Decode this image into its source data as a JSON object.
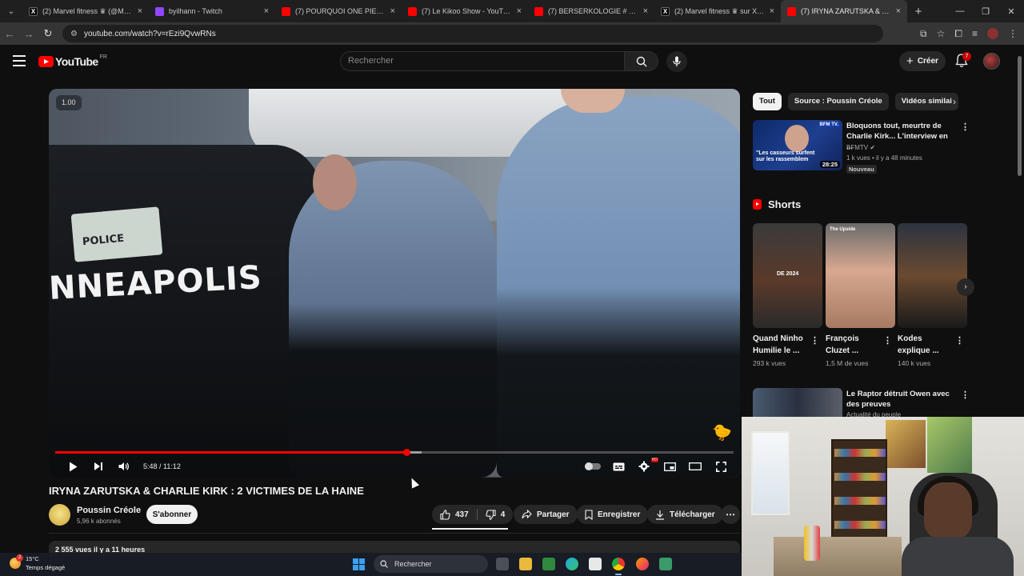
{
  "browser": {
    "tabs": [
      {
        "title": "(2) Marvel fitness ♛ (@MarvelF",
        "icon": "x-logo-icon",
        "active": false
      },
      {
        "title": "byilhann - Twitch",
        "icon": "twitch-icon",
        "active": false
      },
      {
        "title": "(7) POURQUOI ONE PIECE DEV",
        "icon": "youtube-icon",
        "active": false
      },
      {
        "title": "(7) Le Kikoo Show - YouTube",
        "icon": "youtube-icon",
        "active": false
      },
      {
        "title": "(7) BERSERKOLOGIE # 1 - L' ar",
        "icon": "youtube-icon",
        "active": false
      },
      {
        "title": "(2) Marvel fitness ♛ sur X : \"@S",
        "icon": "x-logo-icon",
        "active": false
      },
      {
        "title": "(7) IRYNA ZARUTSKA & CHARLI",
        "icon": "youtube-icon",
        "active": true
      }
    ],
    "url": "youtube.com/watch?v=rEzi9QvwRNs"
  },
  "youtube": {
    "logo_text": "YouTube",
    "region": "FR",
    "search_placeholder": "Rechercher",
    "create_label": "Créer",
    "notification_count": "7"
  },
  "player": {
    "speed_badge": "1.00",
    "scene_text_city": "NNEAPOLIS",
    "scene_text_plate": "POLICE",
    "current_time": "5:48",
    "duration": "11:12",
    "time_display": "5:48 / 11:12",
    "progress_fraction": 0.518,
    "buffer_fraction": 0.54,
    "hd_badge": "HD"
  },
  "video": {
    "title": "IRYNA ZARUTSKA & CHARLIE KIRK : 2 VICTIMES DE LA HAINE",
    "channel_name": "Poussin Créole",
    "subscribers": "5,96 k abonnés",
    "subscribe_label": "S'abonner",
    "likes": "437",
    "dislikes": "4",
    "share_label": "Partager",
    "save_label": "Enregistrer",
    "download_label": "Télécharger",
    "description_preview": "2 555 vues  il y a 11 heures"
  },
  "sidebar": {
    "chips": [
      "Tout",
      "Source : Poussin Créole",
      "Vidéos similai"
    ],
    "recommended": [
      {
        "title": "Bloquons tout, meurtre de Charlie Kirk... L'interview en ...",
        "channel": "BFMTV",
        "meta": "1 k vues • il y a 48 minutes",
        "badge": "Nouveau",
        "duration": "28:25",
        "thumb_caption": "\"Les casseurs surfent sur les rassemblem",
        "thumb_logo": "BFM TV."
      },
      {
        "title": "Le Raptor détruit Owen avec des preuves",
        "meta": "Actualité du peuple"
      }
    ],
    "shorts_title": "Shorts",
    "shorts": [
      {
        "title": "Quand Ninho Humilie le ...",
        "views": "293 k vues",
        "thumb_text": "DE 2024"
      },
      {
        "title": "François Cluzet ...",
        "views": "1,5 M de vues",
        "thumb_text": "The Upside"
      },
      {
        "title": "Kodes explique ...",
        "views": "140 k vues",
        "thumb_text": ""
      }
    ]
  },
  "taskbar": {
    "temperature": "15°C",
    "weather": "Temps dégagé",
    "weather_badge": "2",
    "search_label": "Rechercher"
  },
  "colors": {
    "accent_red": "#ff0000",
    "background": "#0f0f0f",
    "surface": "#272727"
  }
}
